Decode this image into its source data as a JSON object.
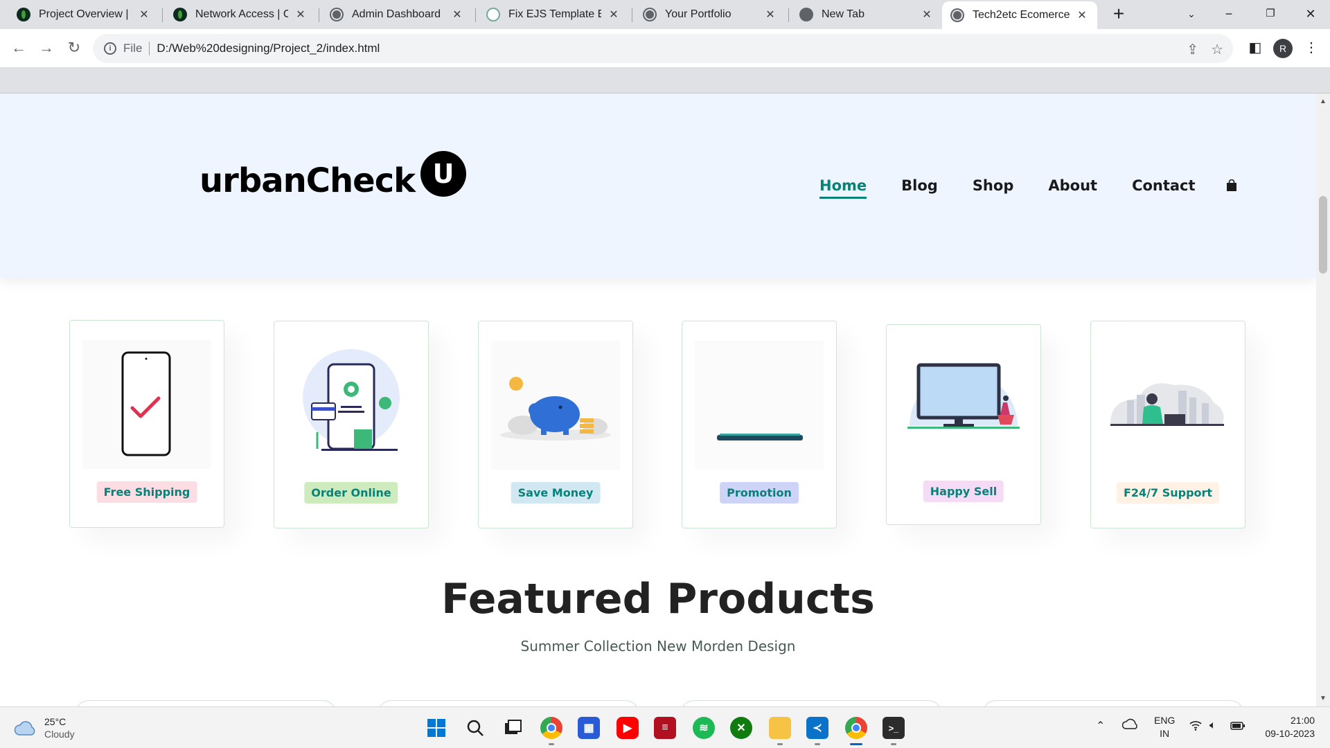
{
  "browser": {
    "tabs": [
      {
        "title": "Project Overview | Clo",
        "favicon": "mongodb-leaf-icon"
      },
      {
        "title": "Network Access | Clo",
        "favicon": "mongodb-leaf-icon"
      },
      {
        "title": "Admin Dashboard",
        "favicon": "globe-icon"
      },
      {
        "title": "Fix EJS Template Erro",
        "favicon": "chatgpt-icon"
      },
      {
        "title": "Your Portfolio",
        "favicon": "globe-icon"
      },
      {
        "title": "New Tab",
        "favicon": "chrome-icon"
      },
      {
        "title": "Tech2etc Ecomerce",
        "favicon": "globe-icon",
        "active": true
      }
    ],
    "address": {
      "scheme_label": "File",
      "url": "D:/Web%20designing/Project_2/index.html"
    },
    "profile_initial": "R"
  },
  "site": {
    "logo_text": "urbanCheck",
    "logo_badge": "U",
    "nav": [
      {
        "label": "Home",
        "active": true
      },
      {
        "label": "Blog"
      },
      {
        "label": "Shop"
      },
      {
        "label": "About"
      },
      {
        "label": "Contact"
      }
    ],
    "features": [
      {
        "label": "Free Shipping",
        "bg": "#fddde4",
        "art": "phone-checkmark"
      },
      {
        "label": "Order Online",
        "bg": "#cdebbc",
        "art": "order-confirmed-phone"
      },
      {
        "label": "Save Money",
        "bg": "#d1e8f2",
        "art": "piggy-bank-coins"
      },
      {
        "label": "Promotion",
        "bg": "#cdd4f8",
        "art": "promotion-bar"
      },
      {
        "label": "Happy Sell",
        "bg": "#f6dbf6",
        "art": "monitor-shopping"
      },
      {
        "label": "F24/7 Support",
        "bg": "#fff2e5",
        "art": "support-person-laptop"
      }
    ],
    "featured": {
      "title": "Featured Products",
      "subtitle": "Summer Collection New Morden Design"
    }
  },
  "taskbar": {
    "weather": {
      "temp": "25°C",
      "condition": "Cloudy"
    },
    "lang": {
      "line1": "ENG",
      "line2": "IN"
    },
    "clock": {
      "time": "21:00",
      "date": "09-10-2023"
    }
  },
  "colors": {
    "accent": "#088178",
    "header_bg": "#eef5ff"
  }
}
